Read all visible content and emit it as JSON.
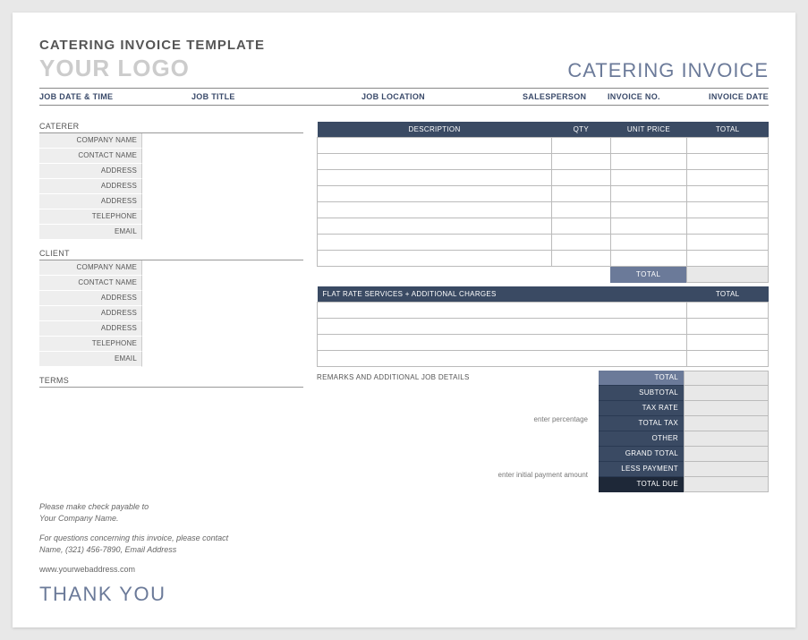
{
  "header": {
    "template_title": "CATERING INVOICE TEMPLATE",
    "logo_text": "YOUR LOGO",
    "doc_title": "CATERING INVOICE"
  },
  "meta": {
    "job_date_time": "JOB DATE & TIME",
    "job_title": "JOB TITLE",
    "job_location": "JOB LOCATION",
    "salesperson": "SALESPERSON",
    "invoice_no": "INVOICE NO.",
    "invoice_date": "INVOICE DATE"
  },
  "caterer": {
    "heading": "CATERER",
    "fields": [
      "COMPANY NAME",
      "CONTACT NAME",
      "ADDRESS",
      "ADDRESS",
      "ADDRESS",
      "TELEPHONE",
      "EMAIL"
    ]
  },
  "client": {
    "heading": "CLIENT",
    "fields": [
      "COMPANY NAME",
      "CONTACT NAME",
      "ADDRESS",
      "ADDRESS",
      "ADDRESS",
      "TELEPHONE",
      "EMAIL"
    ]
  },
  "terms": {
    "heading": "TERMS"
  },
  "items_table": {
    "cols": {
      "desc": "DESCRIPTION",
      "qty": "QTY",
      "unit": "UNIT PRICE",
      "total": "TOTAL"
    },
    "row_count": 8,
    "total_label": "TOTAL"
  },
  "flat_table": {
    "heading": "FLAT RATE SERVICES + ADDITIONAL CHARGES",
    "total_col": "TOTAL",
    "row_count": 4
  },
  "remarks": {
    "heading": "REMARKS AND ADDITIONAL JOB DETAILS",
    "note_percentage": "enter percentage",
    "note_payment": "enter initial payment amount"
  },
  "totals": {
    "rows": [
      {
        "label": "TOTAL",
        "style": "light"
      },
      {
        "label": "SUBTOTAL",
        "style": "normal"
      },
      {
        "label": "TAX RATE",
        "style": "normal"
      },
      {
        "label": "TOTAL TAX",
        "style": "normal"
      },
      {
        "label": "OTHER",
        "style": "normal"
      },
      {
        "label": "GRAND TOTAL",
        "style": "normal"
      },
      {
        "label": "LESS PAYMENT",
        "style": "normal"
      },
      {
        "label": "TOTAL DUE",
        "style": "dark"
      }
    ]
  },
  "footer": {
    "line1": "Please make check payable to",
    "line2": "Your Company Name.",
    "line3": "For questions concerning this invoice, please contact",
    "line4": "Name, (321) 456-7890, Email Address",
    "web": "www.yourwebaddress.com",
    "thank_you": "THANK YOU"
  }
}
